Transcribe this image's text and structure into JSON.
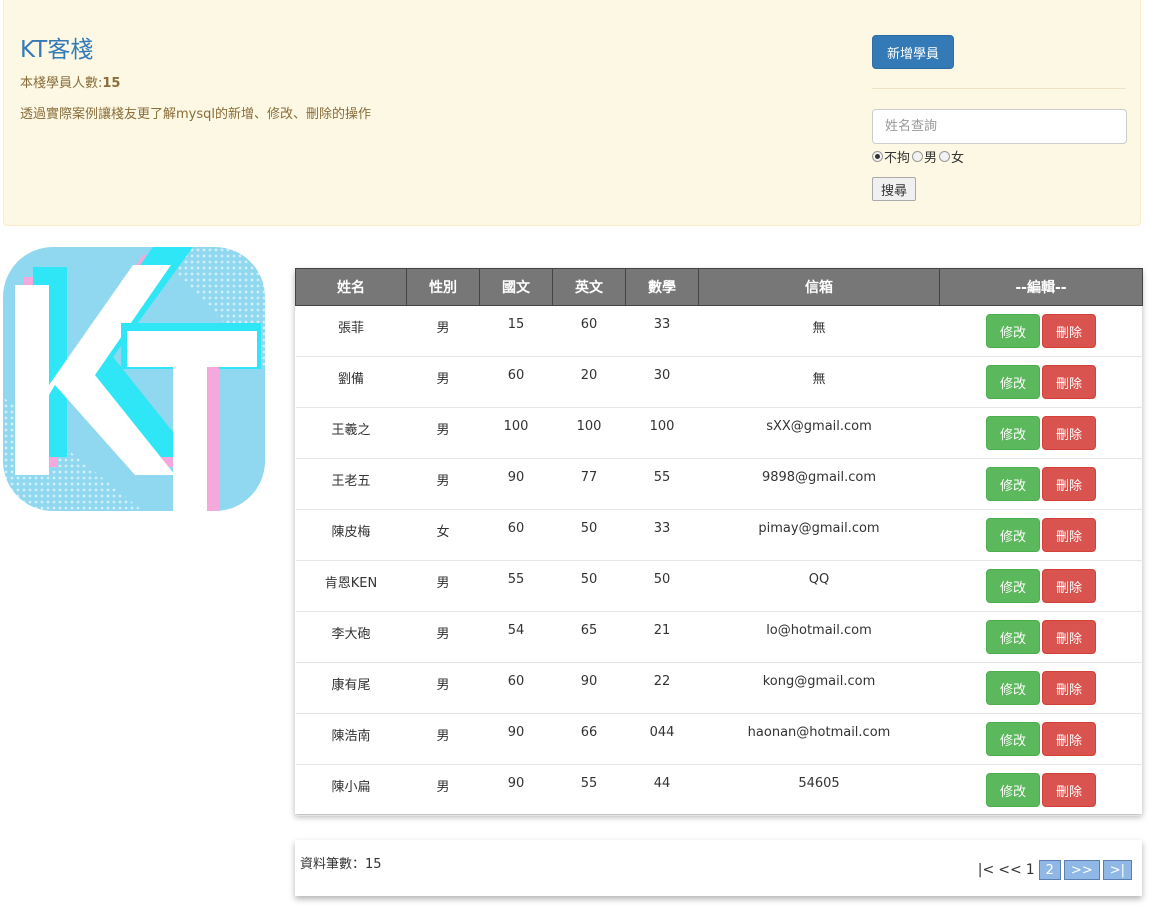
{
  "header": {
    "title": "KT客棧",
    "count_label": "本棧學員人數:",
    "count_value": "15",
    "description": "透過實際案例讓棧友更了解mysql的新增、修改、刪除的操作",
    "add_button": "新增學員"
  },
  "search": {
    "placeholder": "姓名查詢",
    "gender_options": [
      "不拘",
      "男",
      "女"
    ],
    "selected_gender": "不拘",
    "button": "搜尋"
  },
  "logo": {
    "text": "KT"
  },
  "table": {
    "columns": [
      "姓名",
      "性別",
      "國文",
      "英文",
      "數學",
      "信箱",
      "--編輯--"
    ],
    "edit_label": "修改",
    "delete_label": "刪除",
    "rows": [
      [
        "張菲",
        "男",
        "15",
        "60",
        "33",
        "無"
      ],
      [
        "劉備",
        "男",
        "60",
        "20",
        "30",
        "無"
      ],
      [
        "王羲之",
        "男",
        "100",
        "100",
        "100",
        "sXX@gmail.com"
      ],
      [
        "王老五",
        "男",
        "90",
        "77",
        "55",
        "9898@gmail.com"
      ],
      [
        "陳皮梅",
        "女",
        "60",
        "50",
        "33",
        "pimay@gmail.com"
      ],
      [
        "肯恩KEN",
        "男",
        "55",
        "50",
        "50",
        "QQ"
      ],
      [
        "李大砲",
        "男",
        "54",
        "65",
        "21",
        "lo@hotmail.com"
      ],
      [
        "康有尾",
        "男",
        "60",
        "90",
        "22",
        "kong@gmail.com"
      ],
      [
        "陳浩南",
        "男",
        "90",
        "66",
        "044",
        "haonan@hotmail.com"
      ],
      [
        "陳小扁",
        "男",
        "90",
        "55",
        "44",
        "54605"
      ]
    ]
  },
  "footer": {
    "total_label": "資料筆數：",
    "total_value": "15",
    "pager": {
      "first": "|<",
      "prev": "<<",
      "current": "1",
      "page2": "2",
      "next": ">>",
      "last": ">|"
    }
  }
}
